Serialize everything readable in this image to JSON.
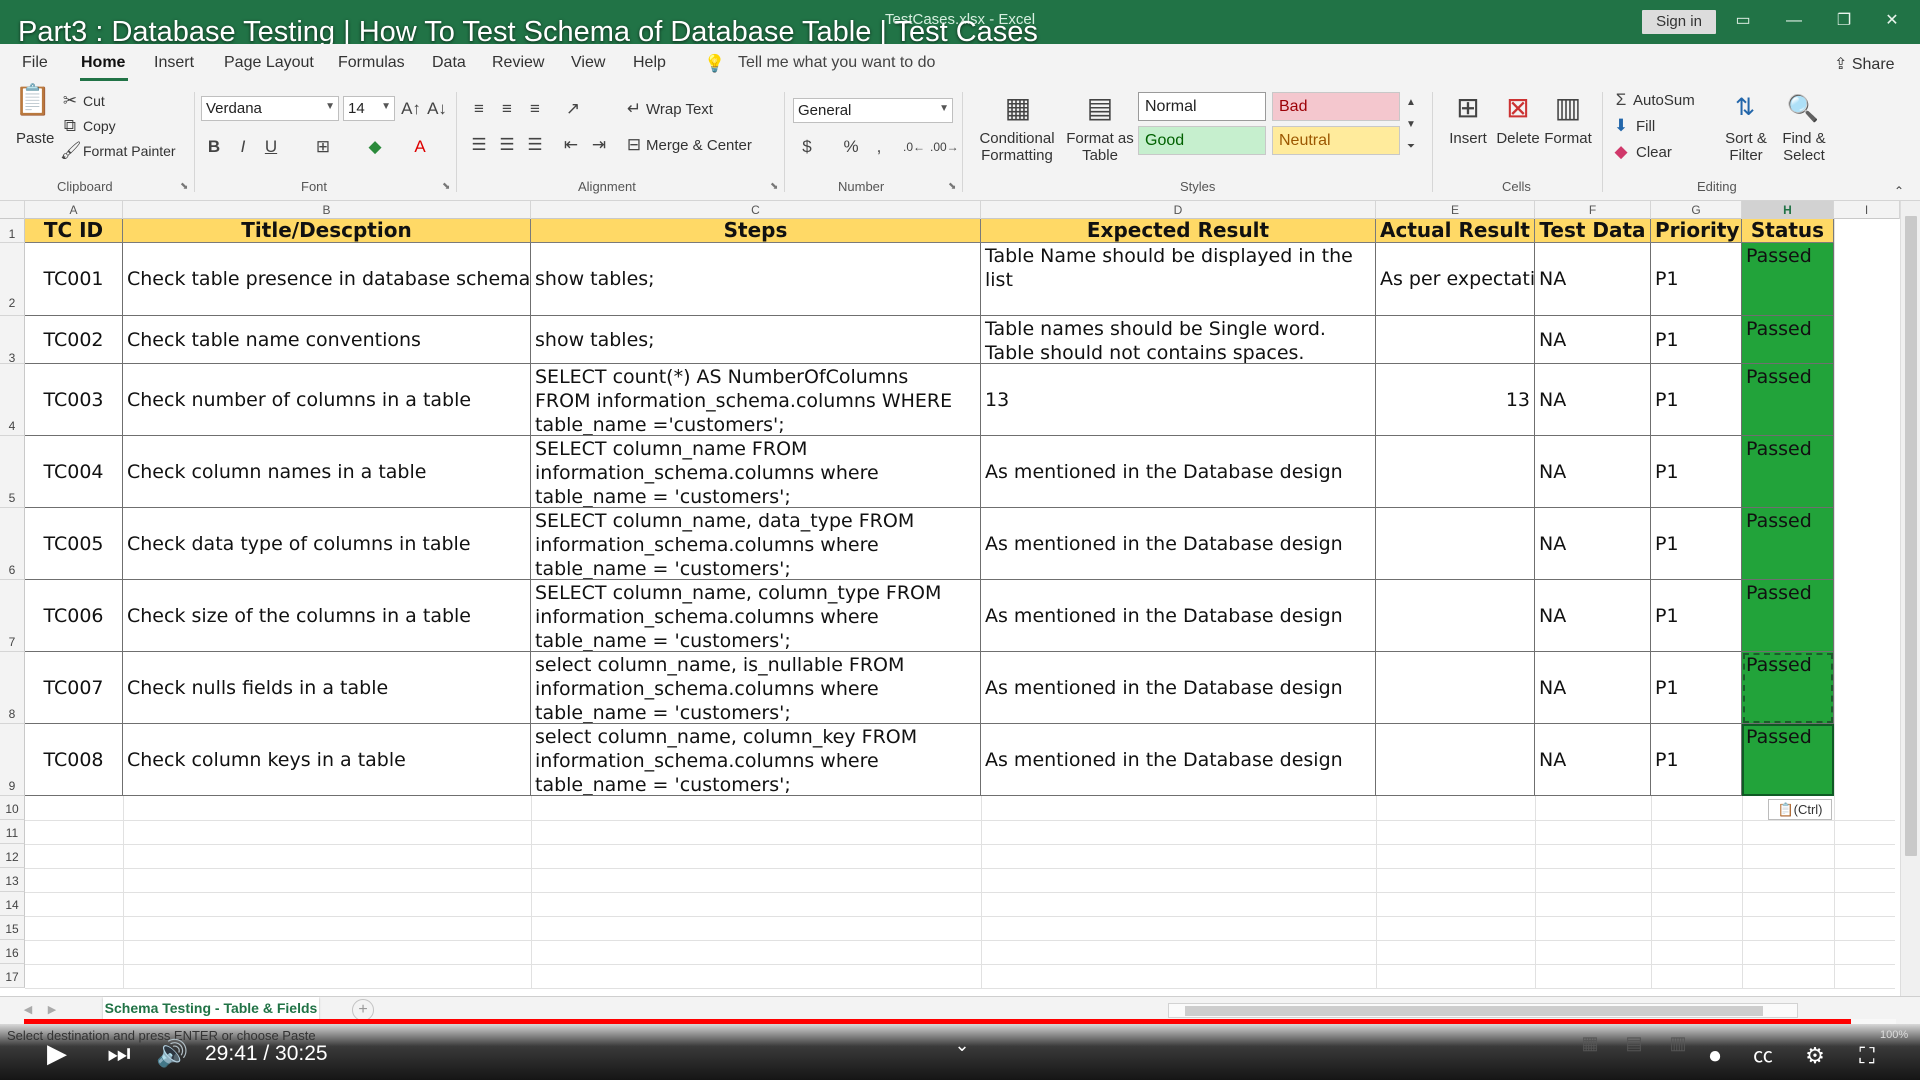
{
  "window": {
    "video_title": "Part3 : Database Testing | How To Test Schema of Database Table | Test Cases",
    "file_title": "TestCases.xlsx  -  Excel",
    "sign_in": "Sign in"
  },
  "menu": {
    "items": [
      "File",
      "Home",
      "Insert",
      "Page Layout",
      "Formulas",
      "Data",
      "Review",
      "View",
      "Help"
    ],
    "tell_me": "Tell me what you want to do",
    "share": "Share"
  },
  "ribbon": {
    "clipboard": {
      "paste": "Paste",
      "cut": "Cut",
      "copy": "Copy",
      "format_painter": "Format Painter",
      "label": "Clipboard"
    },
    "font": {
      "name": "Verdana",
      "size": "14",
      "label": "Font",
      "bold": "B",
      "italic": "I",
      "underline": "U"
    },
    "alignment": {
      "wrap": "Wrap Text",
      "merge": "Merge & Center",
      "label": "Alignment"
    },
    "number": {
      "format": "General",
      "label": "Number",
      "currency": "$",
      "percent": "%",
      "comma": ","
    },
    "styles": {
      "conditional_1": "Conditional",
      "conditional_2": "Formatting",
      "format_table_1": "Format as",
      "format_table_2": "Table",
      "normal": "Normal",
      "bad": "Bad",
      "good": "Good",
      "neutral": "Neutral",
      "label": "Styles"
    },
    "cells": {
      "insert": "Insert",
      "delete": "Delete",
      "format": "Format",
      "label": "Cells"
    },
    "editing": {
      "autosum": "AutoSum",
      "fill": "Fill",
      "clear": "Clear",
      "sort_1": "Sort &",
      "sort_2": "Filter",
      "find_1": "Find &",
      "find_2": "Select",
      "label": "Editing"
    }
  },
  "columns": [
    "A",
    "B",
    "C",
    "D",
    "E",
    "F",
    "G",
    "H",
    "I"
  ],
  "rows": [
    "1",
    "2",
    "3",
    "4",
    "5",
    "6",
    "7",
    "8",
    "9",
    "10",
    "11",
    "12",
    "13",
    "14",
    "15",
    "16",
    "17"
  ],
  "table": {
    "headers": [
      "TC ID",
      "Title/Descption",
      "Steps",
      "Expected Result",
      "Actual Result",
      "Test Data",
      "Priority",
      "Status"
    ],
    "rows": [
      {
        "id": "TC001",
        "title": "Check table presence in database schema",
        "steps": [
          "show tables;"
        ],
        "expected": [
          "Table Name should be displayed in the",
          "list"
        ],
        "actual": "As per expectati",
        "data": "NA",
        "priority": "P1",
        "status": "Passed"
      },
      {
        "id": "TC002",
        "title": "Check table name conventions",
        "steps": [
          "show tables;"
        ],
        "expected": [
          "Table names should be Single word.",
          "Table should not contains spaces."
        ],
        "actual": "",
        "data": "NA",
        "priority": "P1",
        "status": "Passed"
      },
      {
        "id": "TC003",
        "title": "Check number of columns in a table",
        "steps": [
          "SELECT count(*) AS NumberOfColumns",
          "FROM information_schema.columns WHERE",
          "table_name ='customers';"
        ],
        "expected": [
          "13"
        ],
        "actual": "13",
        "data": "NA",
        "priority": "P1",
        "status": "Passed"
      },
      {
        "id": "TC004",
        "title": "Check column names in a table",
        "steps": [
          "SELECT  column_name  FROM",
          "information_schema.columns where",
          "table_name = 'customers';"
        ],
        "expected": [
          "As mentioned in the Database design"
        ],
        "actual": "",
        "data": "NA",
        "priority": "P1",
        "status": "Passed"
      },
      {
        "id": "TC005",
        "title": "Check data type of columns in  table",
        "steps": [
          "SELECT  column_name, data_type FROM",
          "information_schema.columns where",
          "table_name = 'customers';"
        ],
        "expected": [
          "As mentioned in the Database design"
        ],
        "actual": "",
        "data": "NA",
        "priority": "P1",
        "status": "Passed"
      },
      {
        "id": "TC006",
        "title": "Check size of the columns in a  table",
        "steps": [
          "SELECT  column_name, column_type  FROM",
          "information_schema.columns where",
          "table_name = 'customers';"
        ],
        "expected": [
          "As mentioned in the Database design"
        ],
        "actual": "",
        "data": "NA",
        "priority": "P1",
        "status": "Passed"
      },
      {
        "id": "TC007",
        "title": "Check nulls fields in a table",
        "steps": [
          "select column_name, is_nullable  FROM",
          "information_schema.columns where",
          "table_name = 'customers';"
        ],
        "expected": [
          "As mentioned in the Database design"
        ],
        "actual": "",
        "data": "NA",
        "priority": "P1",
        "status": "Passed"
      },
      {
        "id": "TC008",
        "title": "Check column keys in a table",
        "steps": [
          "select column_name, column_key  FROM",
          "information_schema.columns where",
          "table_name = 'customers';"
        ],
        "expected": [
          "As mentioned in the Database design"
        ],
        "actual": "",
        "data": "NA",
        "priority": "P1",
        "status": "Passed"
      }
    ]
  },
  "paste_options": "(Ctrl)",
  "sheet_tab": "Schema Testing - Table & Fields",
  "status_message": "Select destination and press ENTER or choose Paste",
  "video": {
    "timecode": "29:41 / 30:25",
    "progress_fraction": 0.976
  },
  "zoom": "100%",
  "colors": {
    "excel_green": "#217346",
    "header_fill": "#ffd966",
    "status_fill": "#22a33a",
    "progress": "#ff0000"
  }
}
